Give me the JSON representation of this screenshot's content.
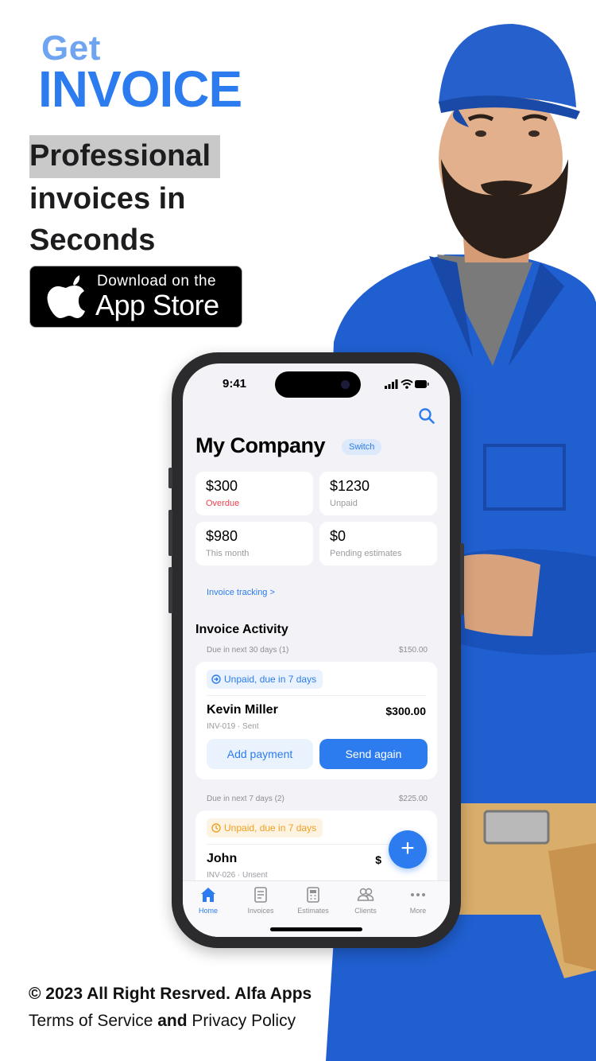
{
  "logo": {
    "get": "Get",
    "invoice": "INVOICE"
  },
  "headline": {
    "line1": "Professional",
    "line2": "invoices in",
    "line3": "Seconds"
  },
  "appstore": {
    "small": "Download on the",
    "big": "App Store"
  },
  "phone": {
    "time": "9:41",
    "company": "My Company",
    "switch_label": "Switch",
    "stats": [
      {
        "amount": "$300",
        "label": "Overdue"
      },
      {
        "amount": "$1230",
        "label": "Unpaid"
      },
      {
        "amount": "$980",
        "label": "This month"
      },
      {
        "amount": "$0",
        "label": "Pending estimates"
      }
    ],
    "tracking_link": "Invoice tracking >",
    "activity_title": "Invoice Activity",
    "groups": [
      {
        "due_label": "Due in next 30 days (1)",
        "total": "$150.00",
        "badge": "Unpaid, due in 7 days",
        "name": "Kevin Miller",
        "amount": "$300.00",
        "meta": "INV-019 · Sent",
        "add_label": "Add payment",
        "send_label": "Send again"
      },
      {
        "due_label": "Due in next 7 days (2)",
        "total": "$225.00",
        "badge": "Unpaid, due in 7 days",
        "name": "John",
        "amount": "$",
        "meta": "INV-026 · Unsent"
      }
    ],
    "tabs": [
      "Home",
      "Invoices",
      "Estimates",
      "Clients",
      "More"
    ],
    "fab": "+"
  },
  "footer": {
    "copyright": "© 2023 All Right Resrved. Alfa Apps",
    "terms": "Terms of Service",
    "and": "and",
    "privacy": "Privacy Policy"
  },
  "colors": {
    "accent": "#2c7cf0",
    "overdue": "#f0414b",
    "warning": "#f0a020",
    "uniform": "#1f5fd0"
  }
}
